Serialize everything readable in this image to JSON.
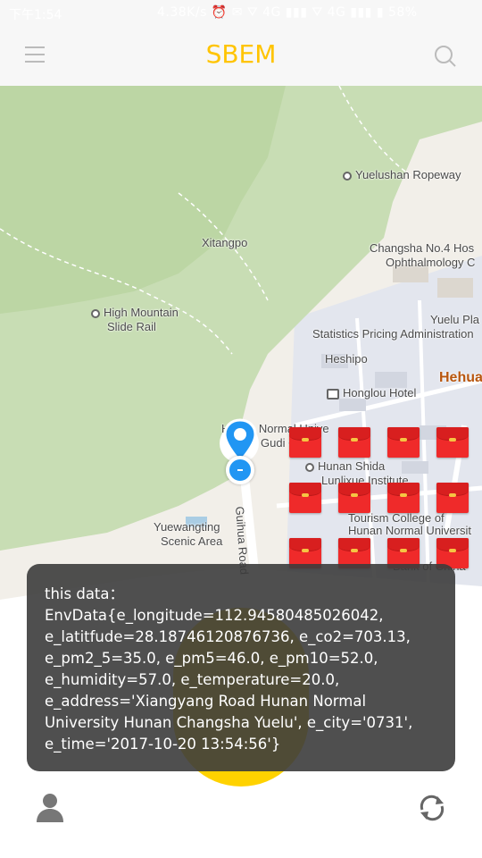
{
  "status_bar": {
    "time": "下午1:54",
    "network": "4.38K/s  ⏰  ✉  ⛛  4G  ▮▮▮  ⛛  4G  ▮▮▮  ▮ 58%"
  },
  "app_bar": {
    "title": "SBEM",
    "menu_icon": "hamburger-menu-icon",
    "search_icon": "search-icon",
    "title_color": "#ffc400"
  },
  "map": {
    "labels": {
      "yuelushan_ropeway": "Yuelushan Ropeway",
      "xitangpo": "Xitangpo",
      "changsha_hosp_1": "Changsha No.4 Hos",
      "changsha_hosp_2": "Ophthalmology C",
      "high_mountain_1": "High Mountain",
      "high_mountain_2": "Slide Rail",
      "yuelu_pla": "Yuelu Pla",
      "statistics": "Statistics Pricing Administration",
      "heshipo": "Heshipo",
      "hehua": "Hehua",
      "honglou": "Honglou Hotel",
      "normal_univ_1": "Hunan Normal Unive",
      "normal_univ_2": "Gudi    Can",
      "shida_1": "Hunan Shida",
      "shida_2": "Lunlixue Institute",
      "tourism_1": "Tourism College of",
      "tourism_2": "Hunan Normal Universit",
      "yuewangting_1": "Yuewangting",
      "yuewangting_2": "Scenic Area",
      "guihua_road": "Guihua Road",
      "bank": "Bank of China"
    }
  },
  "toast": {
    "lines": [
      "this data：",
      "EnvData{e_longitude=112.94580485026042,",
      "e_latitfude=28.18746120876736, e_co2=703.13,",
      "e_pm2_5=35.0, e_pm5=46.0, e_pm10=52.0,",
      "e_humidity=57.0, e_temperature=20.0,",
      "e_address='Xiangyang Road Hunan Normal",
      "University Hunan Changsha Yuelu', e_city='0731',",
      "e_time='2017-10-20 13:54:56'}"
    ]
  },
  "bottom_bar": {
    "user_icon": "user-icon",
    "refresh_icon": "refresh-icon",
    "accent": "#ffd200"
  }
}
